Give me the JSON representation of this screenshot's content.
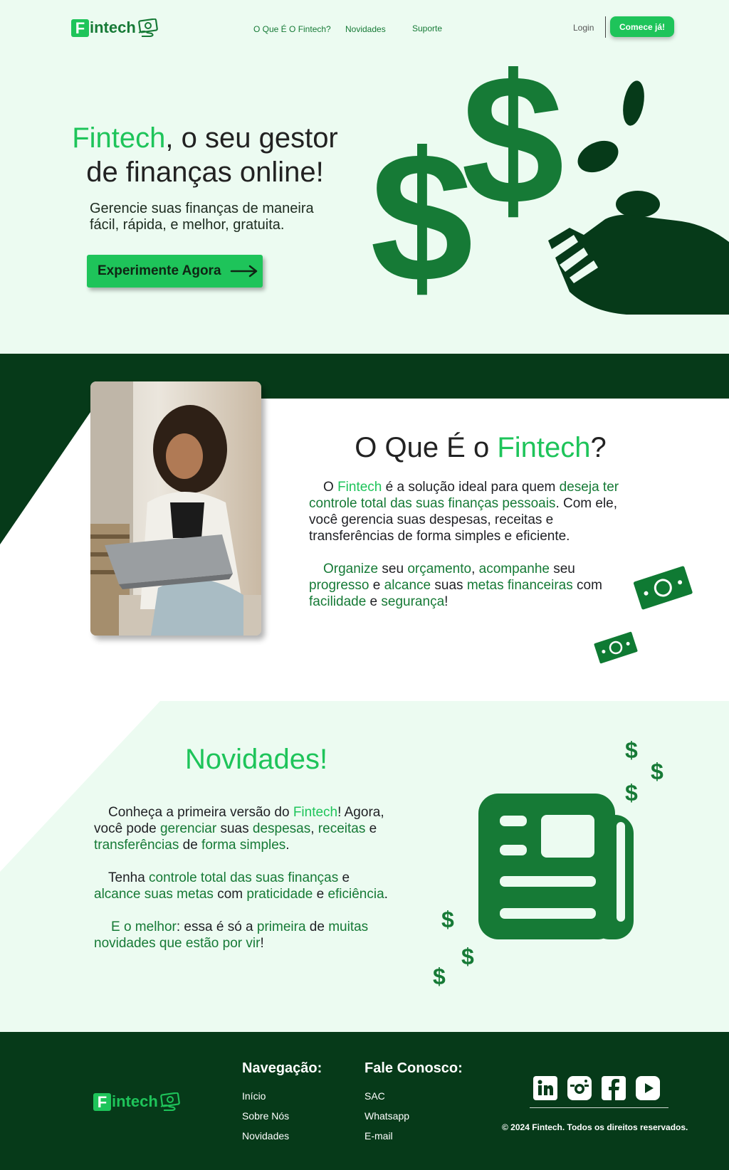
{
  "brand": {
    "logo_letter": "F",
    "logo_rest": "intech"
  },
  "nav": {
    "items": [
      "O Que É O Fintech?",
      "Novidades",
      "Suporte"
    ],
    "login": "Login",
    "cta": "Comece já!"
  },
  "hero": {
    "title_brand": "Fintech",
    "title_line1_rest": ", o seu gestor",
    "title_line2": "de finanças online!",
    "subtitle_line1": "Gerencie suas finanças de maneira",
    "subtitle_line2": "fácil, rápida, e melhor, gratuita.",
    "button": "Experimente Agora"
  },
  "about": {
    "title_pre": "O Que É o ",
    "title_brand": "Fintech",
    "title_post": "?",
    "p1": [
      [
        "O ",
        "d"
      ],
      [
        "Fintech",
        "l"
      ],
      [
        " é a solução ideal para quem ",
        "d"
      ],
      [
        "deseja ter",
        "g"
      ],
      [
        "\n",
        "br"
      ],
      [
        "controle total das suas finanças pessoais",
        "g"
      ],
      [
        ". Com ele,",
        "d"
      ],
      [
        "\n",
        "br"
      ],
      [
        "você gerencia suas despesas, receitas e",
        "d"
      ],
      [
        "\n",
        "br"
      ],
      [
        "transferências de forma simples e eficiente.",
        "d"
      ]
    ],
    "p2": [
      [
        "Organize",
        "g"
      ],
      [
        " seu ",
        "d"
      ],
      [
        "orçamento",
        "g"
      ],
      [
        ", ",
        "d"
      ],
      [
        "acompanhe",
        "g"
      ],
      [
        " seu",
        "d"
      ],
      [
        "\n",
        "br"
      ],
      [
        "progresso",
        "g"
      ],
      [
        " e ",
        "d"
      ],
      [
        "alcance",
        "g"
      ],
      [
        " suas ",
        "d"
      ],
      [
        "metas financeiras",
        "g"
      ],
      [
        " com",
        "d"
      ],
      [
        "\n",
        "br"
      ],
      [
        "facilidade",
        "g"
      ],
      [
        " e ",
        "d"
      ],
      [
        "segurança",
        "g"
      ],
      [
        "!",
        "d"
      ]
    ]
  },
  "news": {
    "title": "Novidades!",
    "p1": [
      [
        "Conheça a primeira versão do ",
        "d"
      ],
      [
        "Fintech",
        "l"
      ],
      [
        "! Agora,",
        "d"
      ],
      [
        "\n",
        "br"
      ],
      [
        "você pode ",
        "d"
      ],
      [
        "gerenciar",
        "g"
      ],
      [
        " suas ",
        "d"
      ],
      [
        "despesas",
        "g"
      ],
      [
        ", ",
        "d"
      ],
      [
        "receitas",
        "g"
      ],
      [
        " e",
        "d"
      ],
      [
        "\n",
        "br"
      ],
      [
        "transferências",
        "g"
      ],
      [
        " de ",
        "d"
      ],
      [
        "forma simples",
        "g"
      ],
      [
        ".",
        "d"
      ]
    ],
    "p2": [
      [
        "Tenha ",
        "d"
      ],
      [
        "controle total das suas finanças",
        "g"
      ],
      [
        " e",
        "d"
      ],
      [
        "\n",
        "br"
      ],
      [
        "alcance suas metas",
        "g"
      ],
      [
        " com ",
        "d"
      ],
      [
        "praticidade",
        "g"
      ],
      [
        " e ",
        "d"
      ],
      [
        "eficiência",
        "g"
      ],
      [
        ".",
        "d"
      ]
    ],
    "p3": [
      [
        "E o melhor",
        "g"
      ],
      [
        ": essa é só a ",
        "d"
      ],
      [
        "primeira",
        "g"
      ],
      [
        " de ",
        "d"
      ],
      [
        "muitas",
        "g"
      ],
      [
        "\n",
        "br"
      ],
      [
        "novidades que estão por vir",
        "g"
      ],
      [
        "!",
        "d"
      ]
    ]
  },
  "footer": {
    "nav_title": "Navegação:",
    "nav_items": [
      "Início",
      "Sobre Nós",
      "Novidades"
    ],
    "contact_title": "Fale Conosco:",
    "contact_items": [
      "SAC",
      "Whatsapp",
      "E-mail"
    ],
    "social_icons": [
      "linkedin-icon",
      "instagram-icon",
      "facebook-icon",
      "youtube-icon"
    ],
    "copyright": "© 2024 Fintech. Todos os direitos reservados."
  },
  "colors": {
    "accent_light": "#1ec45a",
    "accent_dark": "#167a36",
    "deep_green": "#063a19",
    "background": "#ecfbf1"
  }
}
